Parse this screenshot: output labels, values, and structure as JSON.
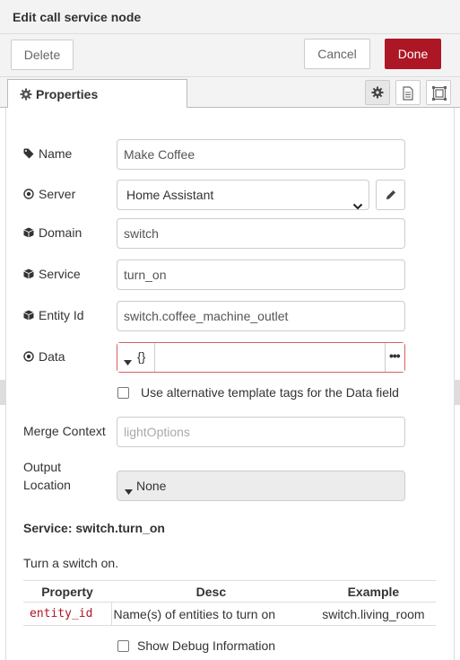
{
  "header": {
    "title": "Edit call service node"
  },
  "toolbar": {
    "delete_label": "Delete",
    "cancel_label": "Cancel",
    "done_label": "Done"
  },
  "tabs": {
    "properties_label": "Properties"
  },
  "form": {
    "name": {
      "label": "Name",
      "value": "Make Coffee"
    },
    "server": {
      "label": "Server",
      "value": "Home Assistant"
    },
    "domain": {
      "label": "Domain",
      "value": "switch"
    },
    "service": {
      "label": "Service",
      "value": "turn_on"
    },
    "entity_id": {
      "label": "Entity Id",
      "value": "switch.coffee_machine_outlet"
    },
    "data": {
      "label": "Data",
      "type_label": "{}",
      "more_label": "•••"
    },
    "alt_template": {
      "label": "Use alternative template tags for the Data field",
      "checked": false
    },
    "merge_context": {
      "label": "Merge Context",
      "placeholder": "lightOptions"
    },
    "output_location": {
      "label_line1": "Output",
      "label_line2": "Location",
      "value": "None"
    }
  },
  "service_info": {
    "title": "Service: switch.turn_on",
    "description": "Turn a switch on.",
    "table": {
      "headers": [
        "Property",
        "Desc",
        "Example"
      ],
      "rows": [
        {
          "property": "entity_id",
          "desc": "Name(s) of entities to turn on",
          "example": "switch.living_room"
        }
      ]
    }
  },
  "debug": {
    "label": "Show Debug Information",
    "checked": false
  },
  "colors": {
    "accent": "#ad1625",
    "error_border": "#d6615f",
    "toolbar_bg": "#f3f3f3"
  },
  "icons": {
    "name": "tag-icon",
    "server": "dot-circle-icon",
    "domain": "cube-icon",
    "service": "cube-icon",
    "entity_id": "cube-icon",
    "data": "dot-circle-icon",
    "tab": "gear-icon"
  }
}
